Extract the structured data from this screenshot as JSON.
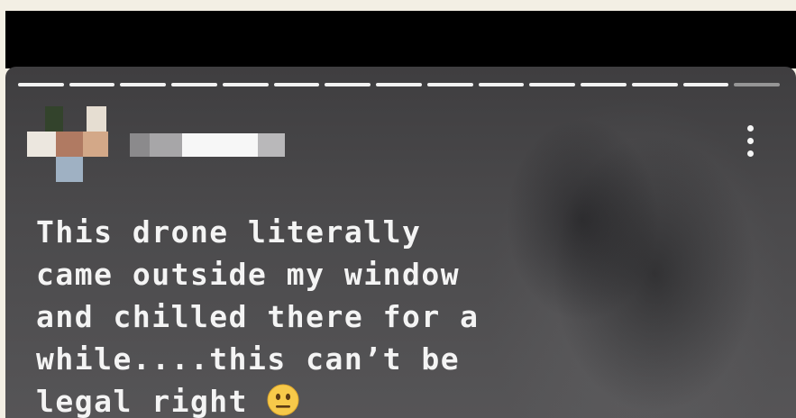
{
  "story": {
    "progress_segments": 15,
    "caption_lines": [
      "This drone literally",
      "came outside my window",
      "and chilled there for a",
      "while....this can’t be",
      "legal right "
    ],
    "caption_emoji": "neutral-face-emoji",
    "menu_icon": "more-vertical-icon",
    "username_blurred": true,
    "avatar_blurred": true
  },
  "colors": {
    "caption_text": "#f4f4f4",
    "progress_active": "#f2f2f2",
    "emoji_face": "#f7c94a"
  }
}
